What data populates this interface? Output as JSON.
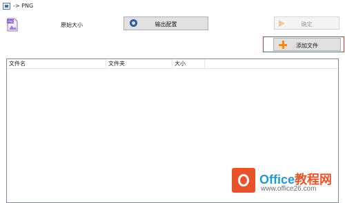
{
  "window": {
    "title": "-> PNG"
  },
  "toolbar": {
    "png_badge": "PNG",
    "original_size_label": "原始大小",
    "output_config_label": "输出配置",
    "ok_label": "确定",
    "add_file_label": "添加文件"
  },
  "file_table": {
    "columns": [
      "文件名",
      "文件夹",
      "大小",
      ""
    ],
    "rows": []
  },
  "watermark": {
    "brand_en": "Office",
    "brand_cn": "教程网",
    "url": "www.office26.com"
  },
  "colors": {
    "highlight_border": "#e0312b",
    "add_icon": "#f08a24",
    "watermark_blue": "#1f9ad6",
    "watermark_orange": "#e8532a"
  }
}
